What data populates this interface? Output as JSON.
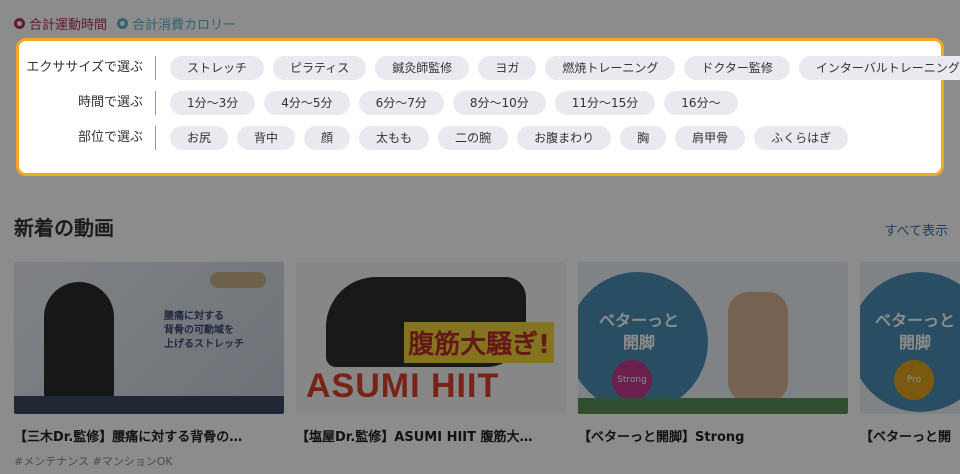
{
  "summary": {
    "items": [
      {
        "label": "合計運動時間",
        "color": "#b0305a",
        "active": true
      },
      {
        "label": "合計消費カロリー",
        "color": "#5bb3c9",
        "active": false
      }
    ]
  },
  "filter": {
    "border_color": "#f5a623",
    "rows": [
      {
        "label": "エクササイズで選ぶ",
        "chips": [
          "ストレッチ",
          "ピラティス",
          "鍼灸師監修",
          "ヨガ",
          "燃焼トレーニング",
          "ドクター監修",
          "インターバルトレーニング"
        ]
      },
      {
        "label": "時間で選ぶ",
        "chips": [
          "1分〜3分",
          "4分〜5分",
          "6分〜7分",
          "8分〜10分",
          "11分〜15分",
          "16分〜"
        ]
      },
      {
        "label": "部位で選ぶ",
        "chips": [
          "お尻",
          "背中",
          "顔",
          "太もも",
          "二の腕",
          "お腹まわり",
          "胸",
          "肩甲骨",
          "ふくらはぎ"
        ]
      }
    ]
  },
  "section": {
    "title": "新着の動画",
    "see_all": "すべて表示"
  },
  "videos": [
    {
      "title": "【三木Dr.監修】腰痛に対する背骨の…",
      "tags": "#メンテナンス #マンションOK",
      "thumb_text": "腰痛に対する\n背骨の可動域を\n上げるストレッチ"
    },
    {
      "title": "【塩屋Dr.監修】ASUMI HIIT 腹筋大…",
      "tags": "",
      "thumb_text": "ASUMI HIIT",
      "thumb_jp": "腹筋大騒ぎ!"
    },
    {
      "title": "【ベターっと開脚】Strong",
      "tags": "",
      "thumb_text": "ベターっと\n開脚",
      "badge": "Strong"
    },
    {
      "title": "【ベターっと開",
      "tags": "",
      "thumb_text": "ベターっと\n開脚",
      "badge": "Pro"
    }
  ]
}
